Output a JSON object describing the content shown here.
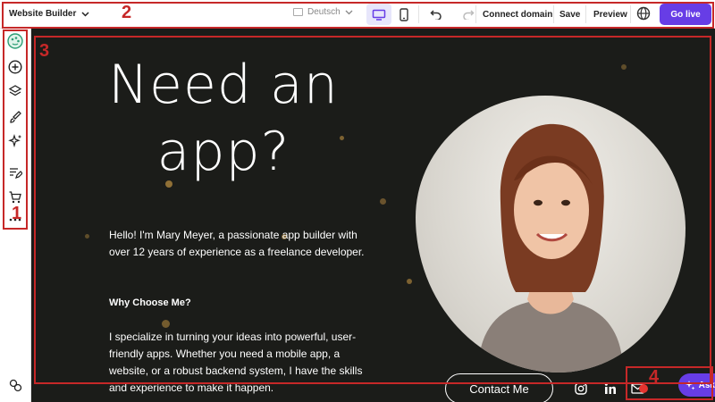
{
  "toolbar": {
    "site_label": "Website Builder",
    "language": "Deutsch",
    "connect_domain": "Connect domain",
    "save": "Save",
    "preview": "Preview",
    "go_live": "Go live"
  },
  "hero": {
    "title": "Need an app?",
    "intro": "Hello! I'm Mary Meyer, a passionate app builder with over 12 years of experience as a freelance developer.",
    "why_heading": "Why Choose Me?",
    "description": "I specialize in turning your ideas into powerful, user-friendly apps. Whether you need a mobile app, a website, or a robust backend system, I have the skills and experience to make it happen.",
    "contact_button": "Contact Me"
  },
  "chat": {
    "ask_ai": "Ask AI"
  },
  "annotations": [
    "1",
    "2",
    "3",
    "4"
  ],
  "icons": {
    "sidebar": [
      "palette-icon",
      "add-circle-icon",
      "layers-icon",
      "brush-icon",
      "sparkle-icon",
      "edit-note-icon",
      "cart-icon",
      "more-icon",
      "settings-icon"
    ],
    "toolbar": [
      "chevron-down-icon",
      "flag-icon",
      "desktop-icon",
      "mobile-icon",
      "undo-icon",
      "redo-icon",
      "globe-icon"
    ],
    "social": [
      "instagram-icon",
      "linkedin-icon",
      "mail-icon"
    ]
  },
  "colors": {
    "accent": "#673de6",
    "canvas_bg": "#1b1c19",
    "annotation": "#c62828"
  }
}
